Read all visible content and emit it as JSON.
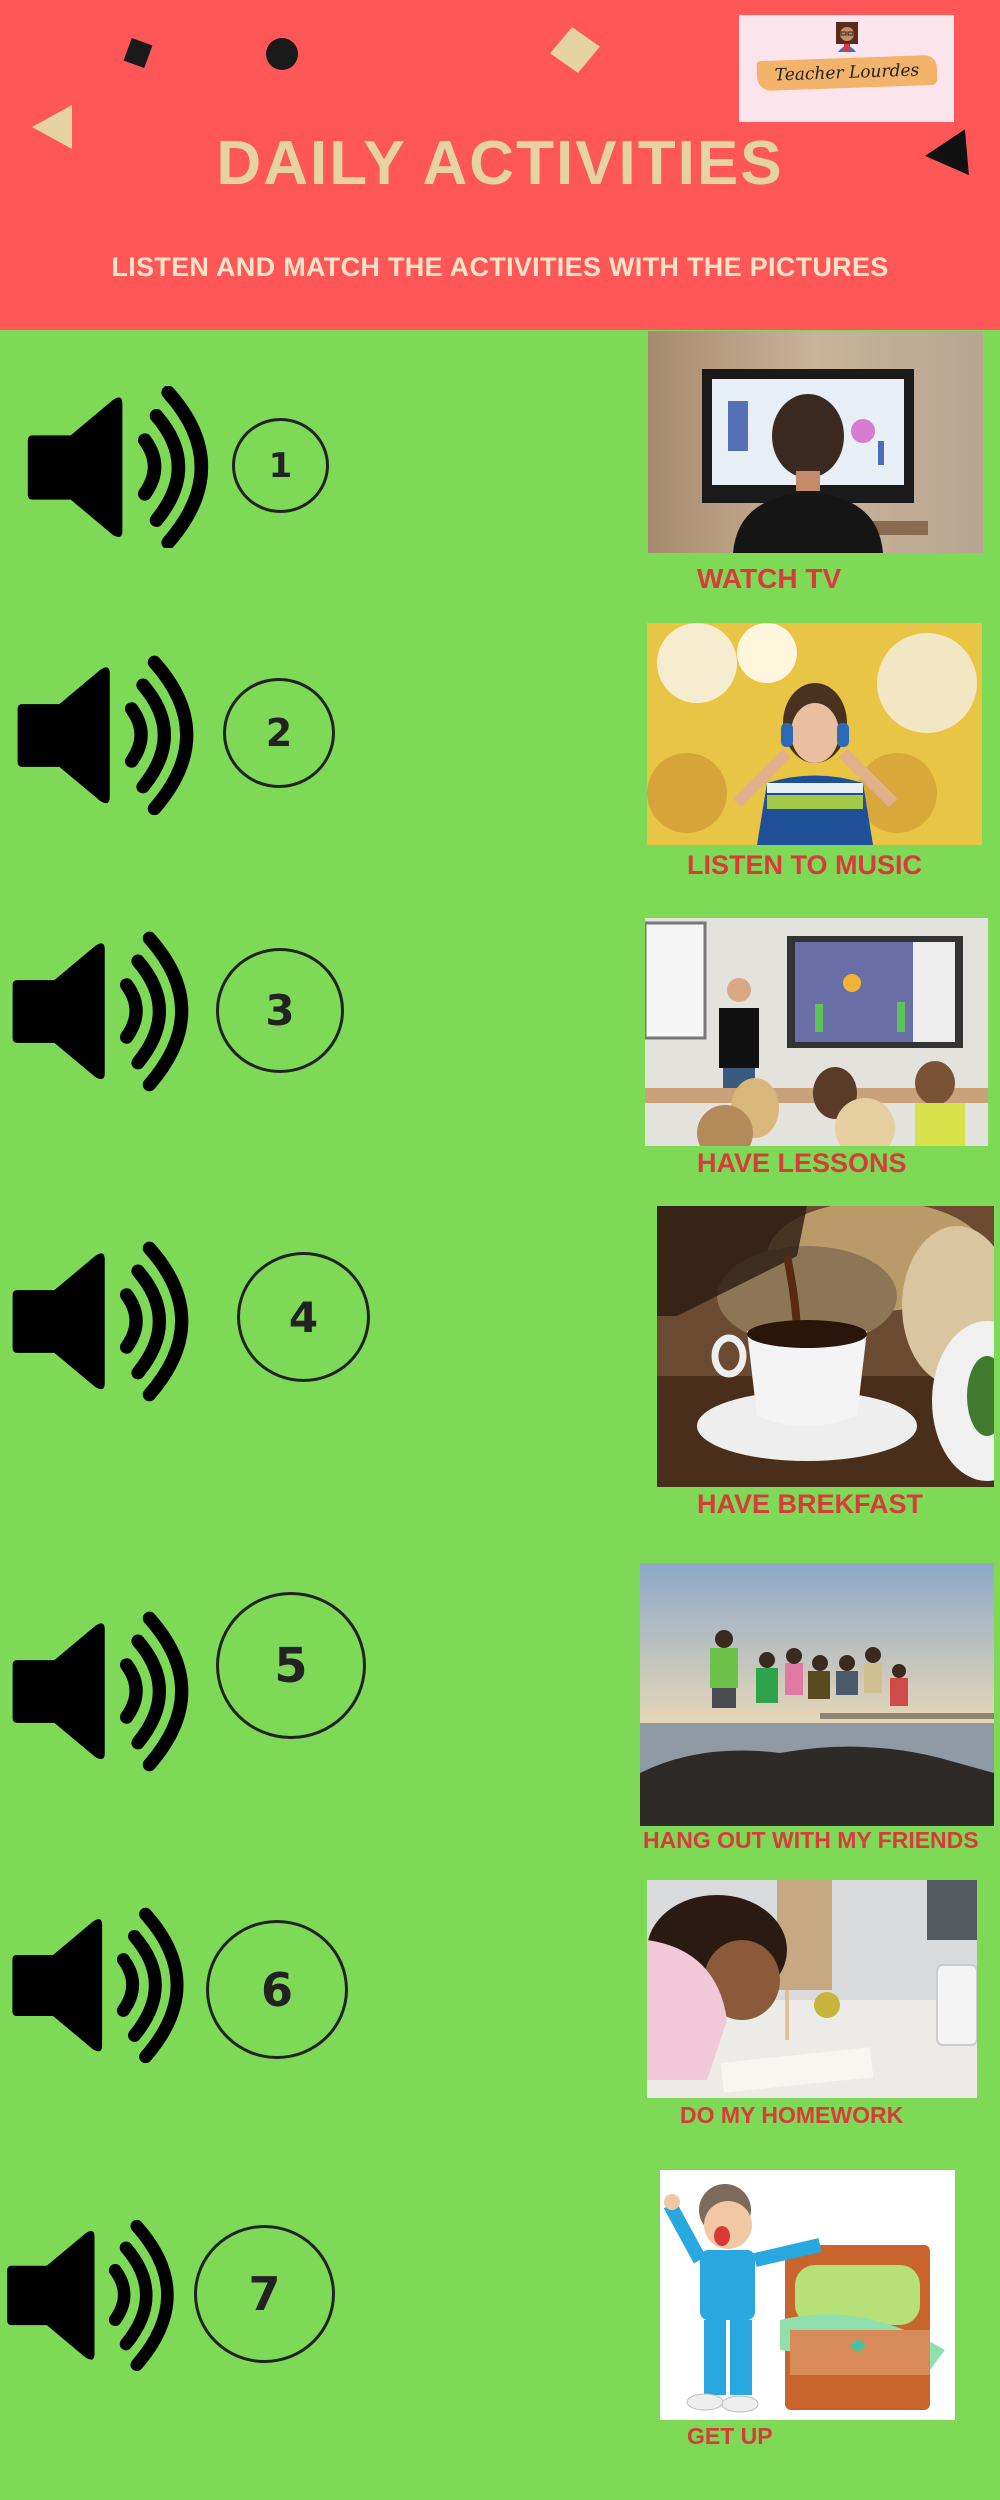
{
  "header": {
    "title": "DAILY ACTIVITIES",
    "subtitle": "LISTEN AND MATCH THE ACTIVITIES WITH THE PICTURES",
    "logo_text": "Teacher Lourdes"
  },
  "colors": {
    "header_bg": "#ff5757",
    "page_bg": "#7ed957",
    "title_text": "#e6d3a3",
    "caption_text": "#d93a3a"
  },
  "audio_items": [
    {
      "number": "1",
      "icon": "speaker-volume-icon"
    },
    {
      "number": "2",
      "icon": "speaker-volume-icon"
    },
    {
      "number": "3",
      "icon": "speaker-volume-icon"
    },
    {
      "number": "4",
      "icon": "speaker-volume-icon"
    },
    {
      "number": "5",
      "icon": "speaker-volume-icon"
    },
    {
      "number": "6",
      "icon": "speaker-volume-icon"
    },
    {
      "number": "7",
      "icon": "speaker-volume-icon"
    }
  ],
  "pictures": [
    {
      "caption": "WATCH TV",
      "image": "boy watching television"
    },
    {
      "caption": "LISTEN TO MUSIC",
      "image": "boy with headphones among yellow trees"
    },
    {
      "caption": "HAVE LESSONS",
      "image": "teacher and pupils in classroom with smartboard"
    },
    {
      "caption": "HAVE BREKFAST",
      "image": "coffee poured into cup with bread"
    },
    {
      "caption": "HANG OUT WITH MY FRIENDS",
      "image": "kids jumping on rocks by the sea"
    },
    {
      "caption": "DO MY HOMEWORK",
      "image": "girl writing in notebook at desk"
    },
    {
      "caption": "GET UP",
      "image": "cartoon boy yawning next to bed"
    }
  ]
}
